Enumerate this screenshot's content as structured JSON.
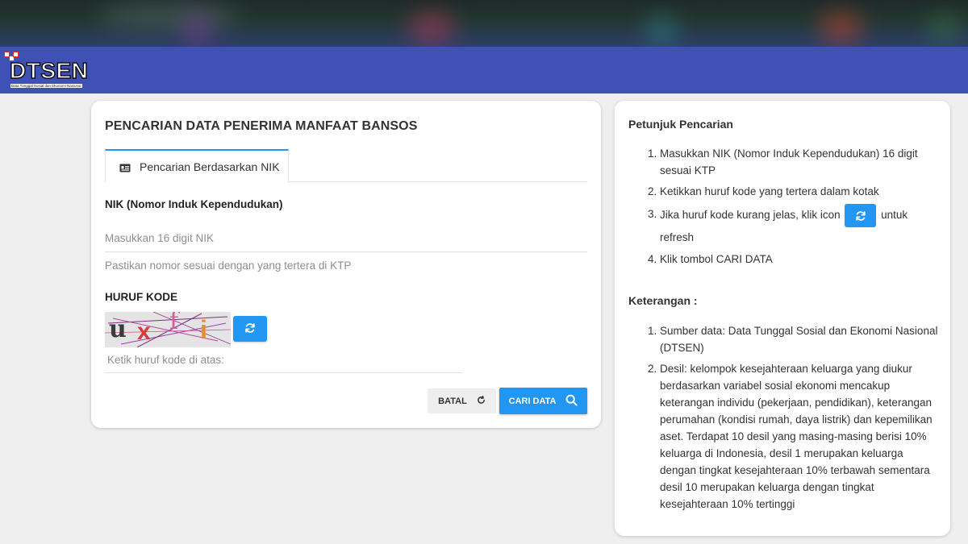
{
  "brand": {
    "name": "DTSEN",
    "subtitle": "Data Tunggal Sosial dan Ekonomi Nasional",
    "navbar_color": "#3f51b5"
  },
  "search_card": {
    "title": "PENCARIAN DATA PENERIMA MANFAAT BANSOS",
    "tab": {
      "label": "Pencarian Berdasarkan NIK",
      "icon": "id-card-icon"
    },
    "nik": {
      "label": "NIK (Nomor Induk Kependudukan)",
      "value": "",
      "placeholder": "Masukkan 16 digit NIK",
      "hint": "Pastikan nomor sesuai dengan yang tertera di KTP"
    },
    "code": {
      "label": "HURUF KODE",
      "captcha_chars": [
        "u",
        "x",
        "f",
        "i"
      ],
      "refresh_icon": "refresh-icon",
      "value": "",
      "placeholder": "Ketik huruf kode di atas:"
    },
    "buttons": {
      "cancel_label": "BATAL",
      "cancel_icon": "reset-icon",
      "search_label": "CARI DATA",
      "search_icon": "search-icon"
    }
  },
  "guide": {
    "title": "Petunjuk Pencarian",
    "steps": [
      "Masukkan NIK (Nomor Induk Kependudukan) 16 digit sesuai KTP",
      "Ketikkan huruf kode yang tertera dalam kotak",
      {
        "before": "Jika huruf kode kurang jelas, klik icon",
        "after": "untuk refresh"
      },
      "Klik tombol CARI DATA"
    ]
  },
  "notes": {
    "title": "Keterangan :",
    "items": [
      "Sumber data: Data Tunggal Sosial dan Ekonomi Nasional (DTSEN)",
      "Desil: kelompok kesejahteraan keluarga yang diukur berdasarkan variabel sosial ekonomi mencakup keterangan individu (pekerjaan, pendidikan), keterangan perumahan (kondisi rumah, daya listrik) dan kepemilikan aset. Terdapat 10 desil yang masing-masing berisi 10% keluarga di Indonesia, desil 1 merupakan keluarga dengan tingkat kesejahteraan 10% terbawah sementara desil 10 merupakan keluarga dengan tingkat kesejahteraan 10% tertinggi"
    ]
  },
  "colors": {
    "accent": "#2196f3",
    "background": "#efefef"
  }
}
